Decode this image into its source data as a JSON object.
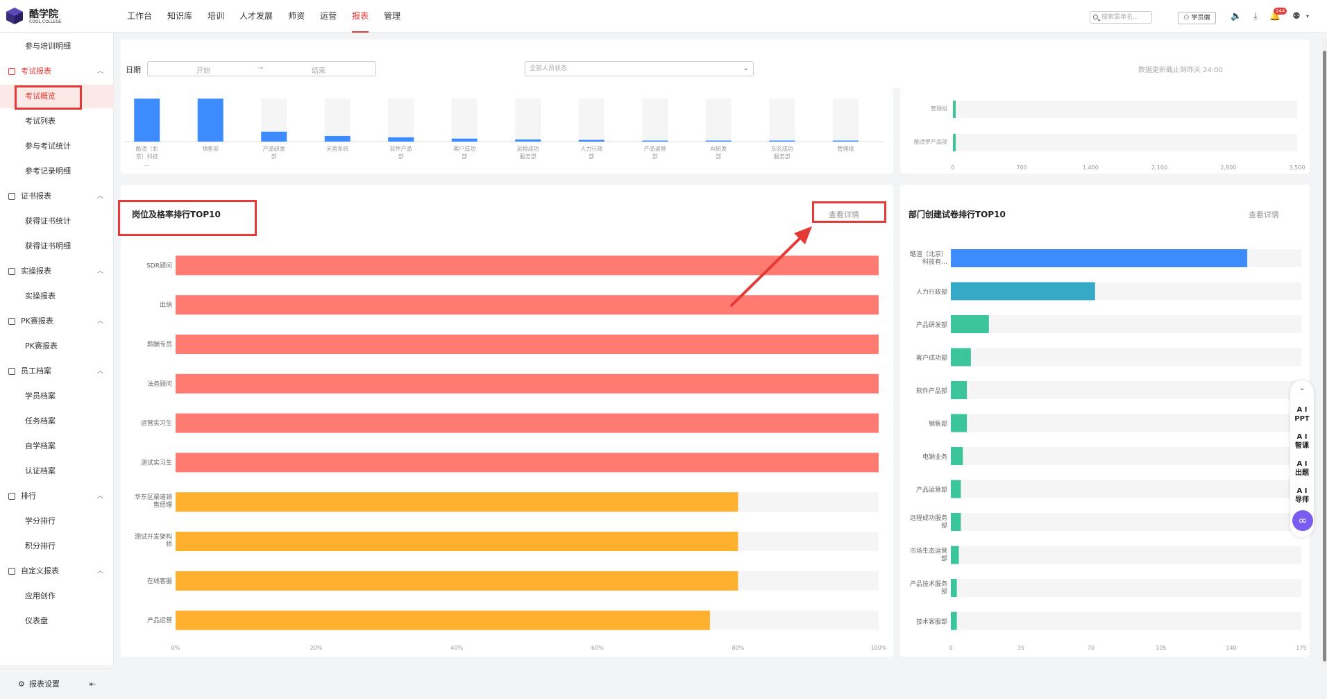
{
  "brand": {
    "name": "酷学院",
    "sub": "COOL COLLEGE"
  },
  "nav": {
    "items": [
      "工作台",
      "知识库",
      "培训",
      "人才发展",
      "师资",
      "运营",
      "报表",
      "管理"
    ],
    "active_index": 6
  },
  "header": {
    "search_placeholder": "搜索菜单名...",
    "learner_button": "学员端",
    "notification_count": "244",
    "icons": [
      "volume-icon",
      "download-icon",
      "bell-icon",
      "avatar-icon"
    ]
  },
  "sidebar": {
    "items": [
      {
        "label": "参与培训明细",
        "kind": "sub"
      },
      {
        "label": "考试报表",
        "kind": "group",
        "expanded": true
      },
      {
        "label": "考试概览",
        "kind": "sub",
        "selected": true
      },
      {
        "label": "考试列表",
        "kind": "sub"
      },
      {
        "label": "参与考试统计",
        "kind": "sub"
      },
      {
        "label": "参考记录明细",
        "kind": "sub"
      },
      {
        "label": "证书报表",
        "kind": "group",
        "expanded": true
      },
      {
        "label": "获得证书统计",
        "kind": "sub"
      },
      {
        "label": "获得证书明细",
        "kind": "sub"
      },
      {
        "label": "实操报表",
        "kind": "group",
        "expanded": true
      },
      {
        "label": "实操报表",
        "kind": "sub"
      },
      {
        "label": "PK赛报表",
        "kind": "group",
        "expanded": true
      },
      {
        "label": "PK赛报表",
        "kind": "sub"
      },
      {
        "label": "员工档案",
        "kind": "group",
        "expanded": true
      },
      {
        "label": "学员档案",
        "kind": "sub"
      },
      {
        "label": "任务档案",
        "kind": "sub"
      },
      {
        "label": "自学档案",
        "kind": "sub"
      },
      {
        "label": "认证档案",
        "kind": "sub"
      },
      {
        "label": "排行",
        "kind": "group",
        "expanded": true
      },
      {
        "label": "学分排行",
        "kind": "sub"
      },
      {
        "label": "积分排行",
        "kind": "sub"
      },
      {
        "label": "自定义报表",
        "kind": "group",
        "expanded": true
      },
      {
        "label": "应用创作",
        "kind": "sub"
      },
      {
        "label": "仪表盘",
        "kind": "sub"
      }
    ],
    "footer_label": "报表设置"
  },
  "filters": {
    "date_label": "日期",
    "start_placeholder": "开始",
    "sep": "→",
    "end_placeholder": "结束",
    "status_placeholder": "全部人员状态",
    "update_note": "数据更新截止到昨天 24:00"
  },
  "chart_data": [
    {
      "type": "bar",
      "id": "top-dept-bars",
      "categories": [
        "酷渲（北京）科技…",
        "销售部",
        "产品研发部",
        "天宫系统",
        "软件产品部",
        "客户成功部",
        "远程成功服务部",
        "人力行政部",
        "产品运营部",
        "AI研发部",
        "东区成功服务部",
        "管理组"
      ],
      "values": [
        1.0,
        1.0,
        0.23,
        0.13,
        0.1,
        0.07,
        0.05,
        0.04,
        0.02,
        0.015,
        0.01,
        0.01
      ],
      "colors": [
        "#3d8bfd"
      ]
    },
    {
      "type": "bar",
      "id": "top-right-bars",
      "orientation": "horizontal",
      "categories": [
        "管理组",
        "酷渲罗产品部"
      ],
      "values": [
        15,
        15
      ],
      "xticks": [
        "0",
        "700",
        "1,400",
        "2,100",
        "2,800",
        "3,500"
      ],
      "xlim": [
        0,
        3500
      ]
    },
    {
      "type": "bar",
      "id": "position-pass-rate",
      "orientation": "horizontal",
      "title": "岗位及格率排行TOP10",
      "categories": [
        "SDR顾问",
        "出纳",
        "薪酬专员",
        "法务顾问",
        "运营实习生",
        "测试实习生",
        "华东区渠道销售经理",
        "测试开发架构师",
        "在线客服",
        "产品运营"
      ],
      "values": [
        100,
        100,
        100,
        100,
        100,
        100,
        80,
        80,
        80,
        76
      ],
      "xticks": [
        "0%",
        "20%",
        "40%",
        "60%",
        "80%",
        "100%"
      ],
      "xlim": [
        0,
        100
      ],
      "colors": [
        "#ff7b72",
        "#ffb02e"
      ]
    },
    {
      "type": "bar",
      "id": "dept-exam-creation",
      "orientation": "horizontal",
      "title": "部门创建试卷排行TOP10",
      "categories": [
        "酷渲（北京）科技有…",
        "人力行政部",
        "产品研发部",
        "客户成功部",
        "软件产品部",
        "销售部",
        "电销业务",
        "产品运营部",
        "远程成功服务部",
        "市场生态运营部",
        "产品技术服务部",
        "技术客服部"
      ],
      "values": [
        148,
        72,
        19,
        10,
        8,
        8,
        6,
        5,
        5,
        4,
        3,
        3
      ],
      "xticks": [
        "0",
        "35",
        "70",
        "105",
        "140",
        "175"
      ],
      "xlim": [
        0,
        175
      ],
      "colors": [
        "#3d8bfd",
        "#36a9c6",
        "#3cc49b"
      ]
    }
  ],
  "cards": {
    "detail_link": "查看详情"
  },
  "fab": {
    "items": [
      "A I PPT",
      "A I 智课",
      "A I 出题",
      "A I 导师"
    ]
  }
}
